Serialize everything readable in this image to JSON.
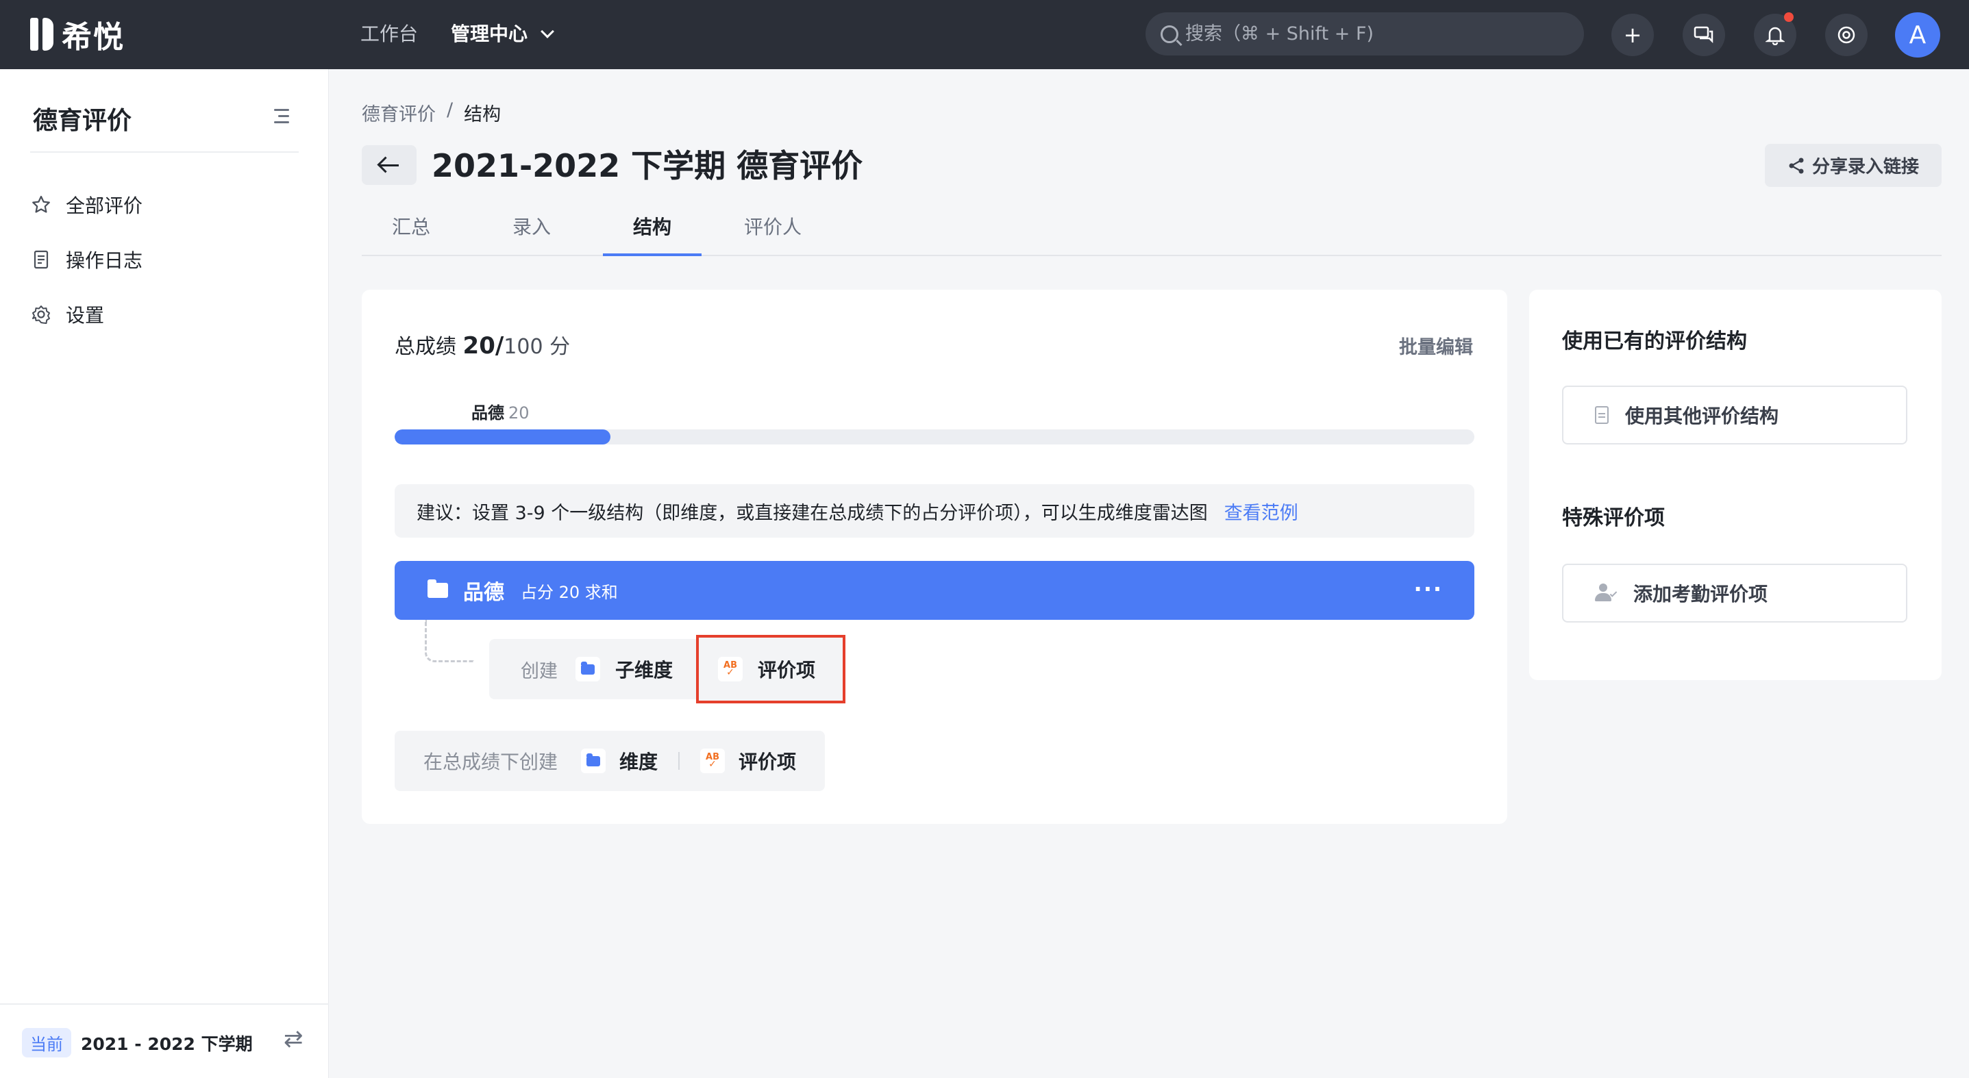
{
  "topbar": {
    "logo_text": "希悦",
    "nav": [
      {
        "label": "工作台"
      },
      {
        "label": "管理中心"
      }
    ],
    "search_placeholder": "搜索（⌘ + Shift + F)",
    "avatar_letter": "A"
  },
  "sidebar": {
    "title": "德育评价",
    "items": [
      {
        "label": "全部评价",
        "icon": "star-icon"
      },
      {
        "label": "操作日志",
        "icon": "log-icon"
      },
      {
        "label": "设置",
        "icon": "gear-icon"
      }
    ],
    "footer": {
      "tag": "当前",
      "term": "2021 - 2022 下学期"
    }
  },
  "main": {
    "breadcrumb": [
      "德育评价",
      "/",
      "结构"
    ],
    "title": "2021-2022 下学期 德育评价",
    "share_label": "分享录入链接",
    "tabs": [
      {
        "label": "汇总"
      },
      {
        "label": "录入"
      },
      {
        "label": "结构",
        "active": true
      },
      {
        "label": "评价人"
      }
    ]
  },
  "structure": {
    "total_label": "总成绩",
    "total_score": "20/",
    "total_max": "100 分",
    "batch_edit": "批量编辑",
    "segment": {
      "name": "品德",
      "value": "20"
    },
    "progress_fraction": 0.2,
    "tip_text": "建议：设置 3-9 个一级结构（即维度，或直接建在总成绩下的占分评价项），可以生成维度雷达图",
    "tip_link": "查看范例",
    "dimension": {
      "name": "品德",
      "subtitle": "占分 20 求和",
      "menu": "···"
    },
    "child_create": {
      "label": "创建",
      "sub_dimension": "子维度",
      "eval_item": "评价项"
    },
    "root_create": {
      "label": "在总成绩下创建",
      "dimension": "维度",
      "eval_item": "评价项"
    }
  },
  "right_panel": {
    "existing_title": "使用已有的评价结构",
    "existing_button": "使用其他评价结构",
    "special_title": "特殊评价项",
    "special_button": "添加考勤评价项"
  },
  "colors": {
    "accent": "#4b7bf5",
    "topbar": "#2b2f38",
    "highlight": "#e53f2c",
    "orange_icon": "#f27022"
  }
}
